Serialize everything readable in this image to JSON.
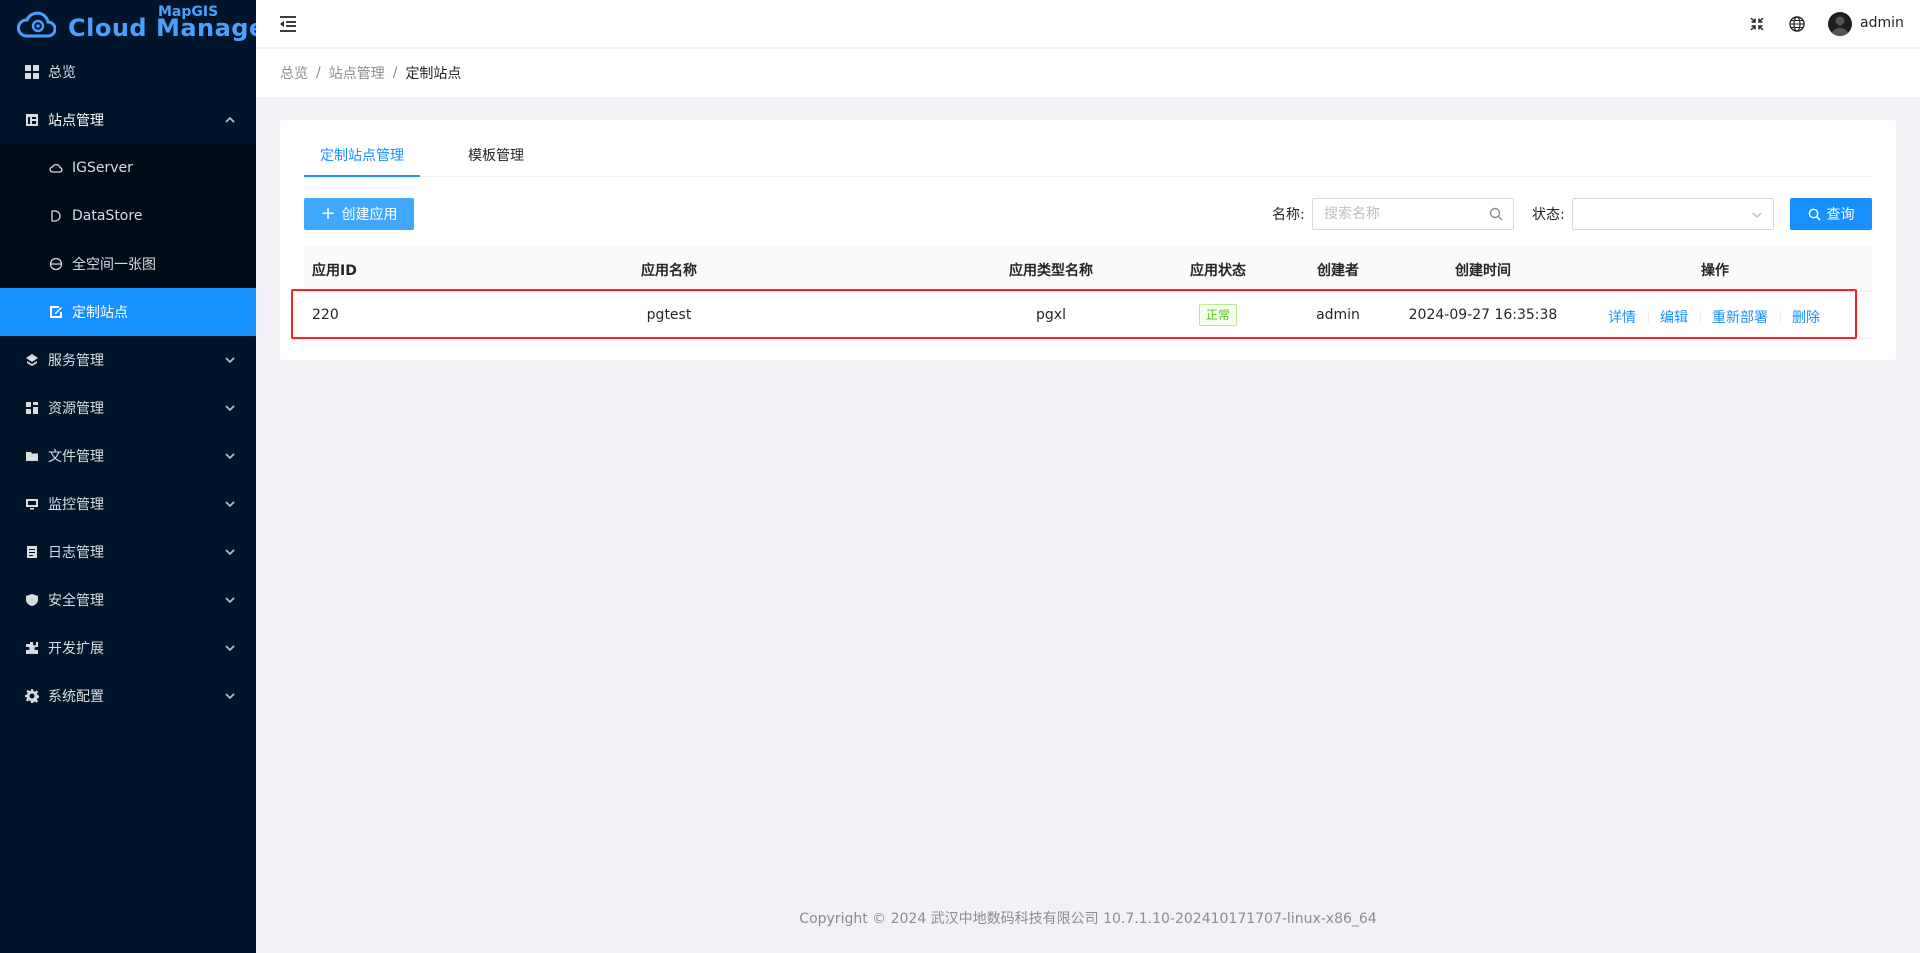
{
  "logo": {
    "brand_top": "MapGIS",
    "brand_main": "Cloud Manager"
  },
  "sidebar": {
    "items": [
      {
        "label": "总览",
        "icon": "dashboard-icon"
      },
      {
        "label": "站点管理",
        "icon": "site-icon",
        "expanded": true
      },
      {
        "label": "服务管理",
        "icon": "service-icon"
      },
      {
        "label": "资源管理",
        "icon": "resource-icon"
      },
      {
        "label": "文件管理",
        "icon": "folder-icon"
      },
      {
        "label": "监控管理",
        "icon": "monitor-icon"
      },
      {
        "label": "日志管理",
        "icon": "log-icon"
      },
      {
        "label": "安全管理",
        "icon": "shield-icon"
      },
      {
        "label": "开发扩展",
        "icon": "plugin-icon"
      },
      {
        "label": "系统配置",
        "icon": "gear-icon"
      }
    ],
    "sub_items": [
      {
        "label": "IGServer",
        "icon": "cloud-icon"
      },
      {
        "label": "DataStore",
        "icon": "datastore-icon"
      },
      {
        "label": "全空间一张图",
        "icon": "globe-icon"
      },
      {
        "label": "定制站点",
        "icon": "edit-icon",
        "active": true
      }
    ]
  },
  "header": {
    "username": "admin"
  },
  "breadcrumb": {
    "items": [
      "总览",
      "站点管理",
      "定制站点"
    ]
  },
  "tabs": [
    "定制站点管理",
    "模板管理"
  ],
  "toolbar": {
    "create_label": "创建应用",
    "name_label": "名称:",
    "search_placeholder": "搜索名称",
    "status_label": "状态:",
    "status_value": "",
    "query_label": "查询"
  },
  "table": {
    "columns": [
      "应用ID",
      "应用名称",
      "应用类型名称",
      "应用状态",
      "创建者",
      "创建时间",
      "操作"
    ],
    "rows": [
      {
        "id": "220",
        "name": "pgtest",
        "type": "pgxl",
        "status": "正常",
        "creator": "admin",
        "created": "2024-09-27 16:35:38",
        "actions": [
          "详情",
          "编辑",
          "重新部署",
          "删除"
        ]
      }
    ]
  },
  "footer": {
    "text": "Copyright © 2024 武汉中地数码科技有限公司 10.7.1.10-202410171707-linux-x86_64"
  },
  "colors": {
    "primary": "#1890ff",
    "sidebar_bg": "#001529",
    "success": "#52c41a",
    "highlight": "#ff1f1f"
  }
}
